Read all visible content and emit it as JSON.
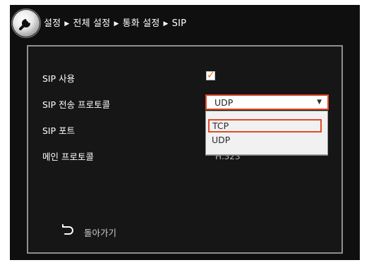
{
  "breadcrumb": [
    "설정",
    "전체 설정",
    "통화 설정",
    "SIP"
  ],
  "rows": [
    {
      "label": "SIP 사용"
    },
    {
      "label": "SIP 전송 프로토콜"
    },
    {
      "label": "SIP 포트"
    },
    {
      "label": "메인 프로토콜"
    }
  ],
  "sip_enabled": {
    "checked": true
  },
  "transport_select": {
    "value": "UDP",
    "options": [
      "TCP",
      "UDP"
    ],
    "highlighted": "TCP"
  },
  "main_protocol_obscured_text": "H.323",
  "back_button": {
    "label": "돌아가기"
  },
  "colors": {
    "accent": "#e14b27",
    "check": "#f26b1d",
    "background": "#0f0f0f",
    "panel_border": "#8f8f8f"
  }
}
